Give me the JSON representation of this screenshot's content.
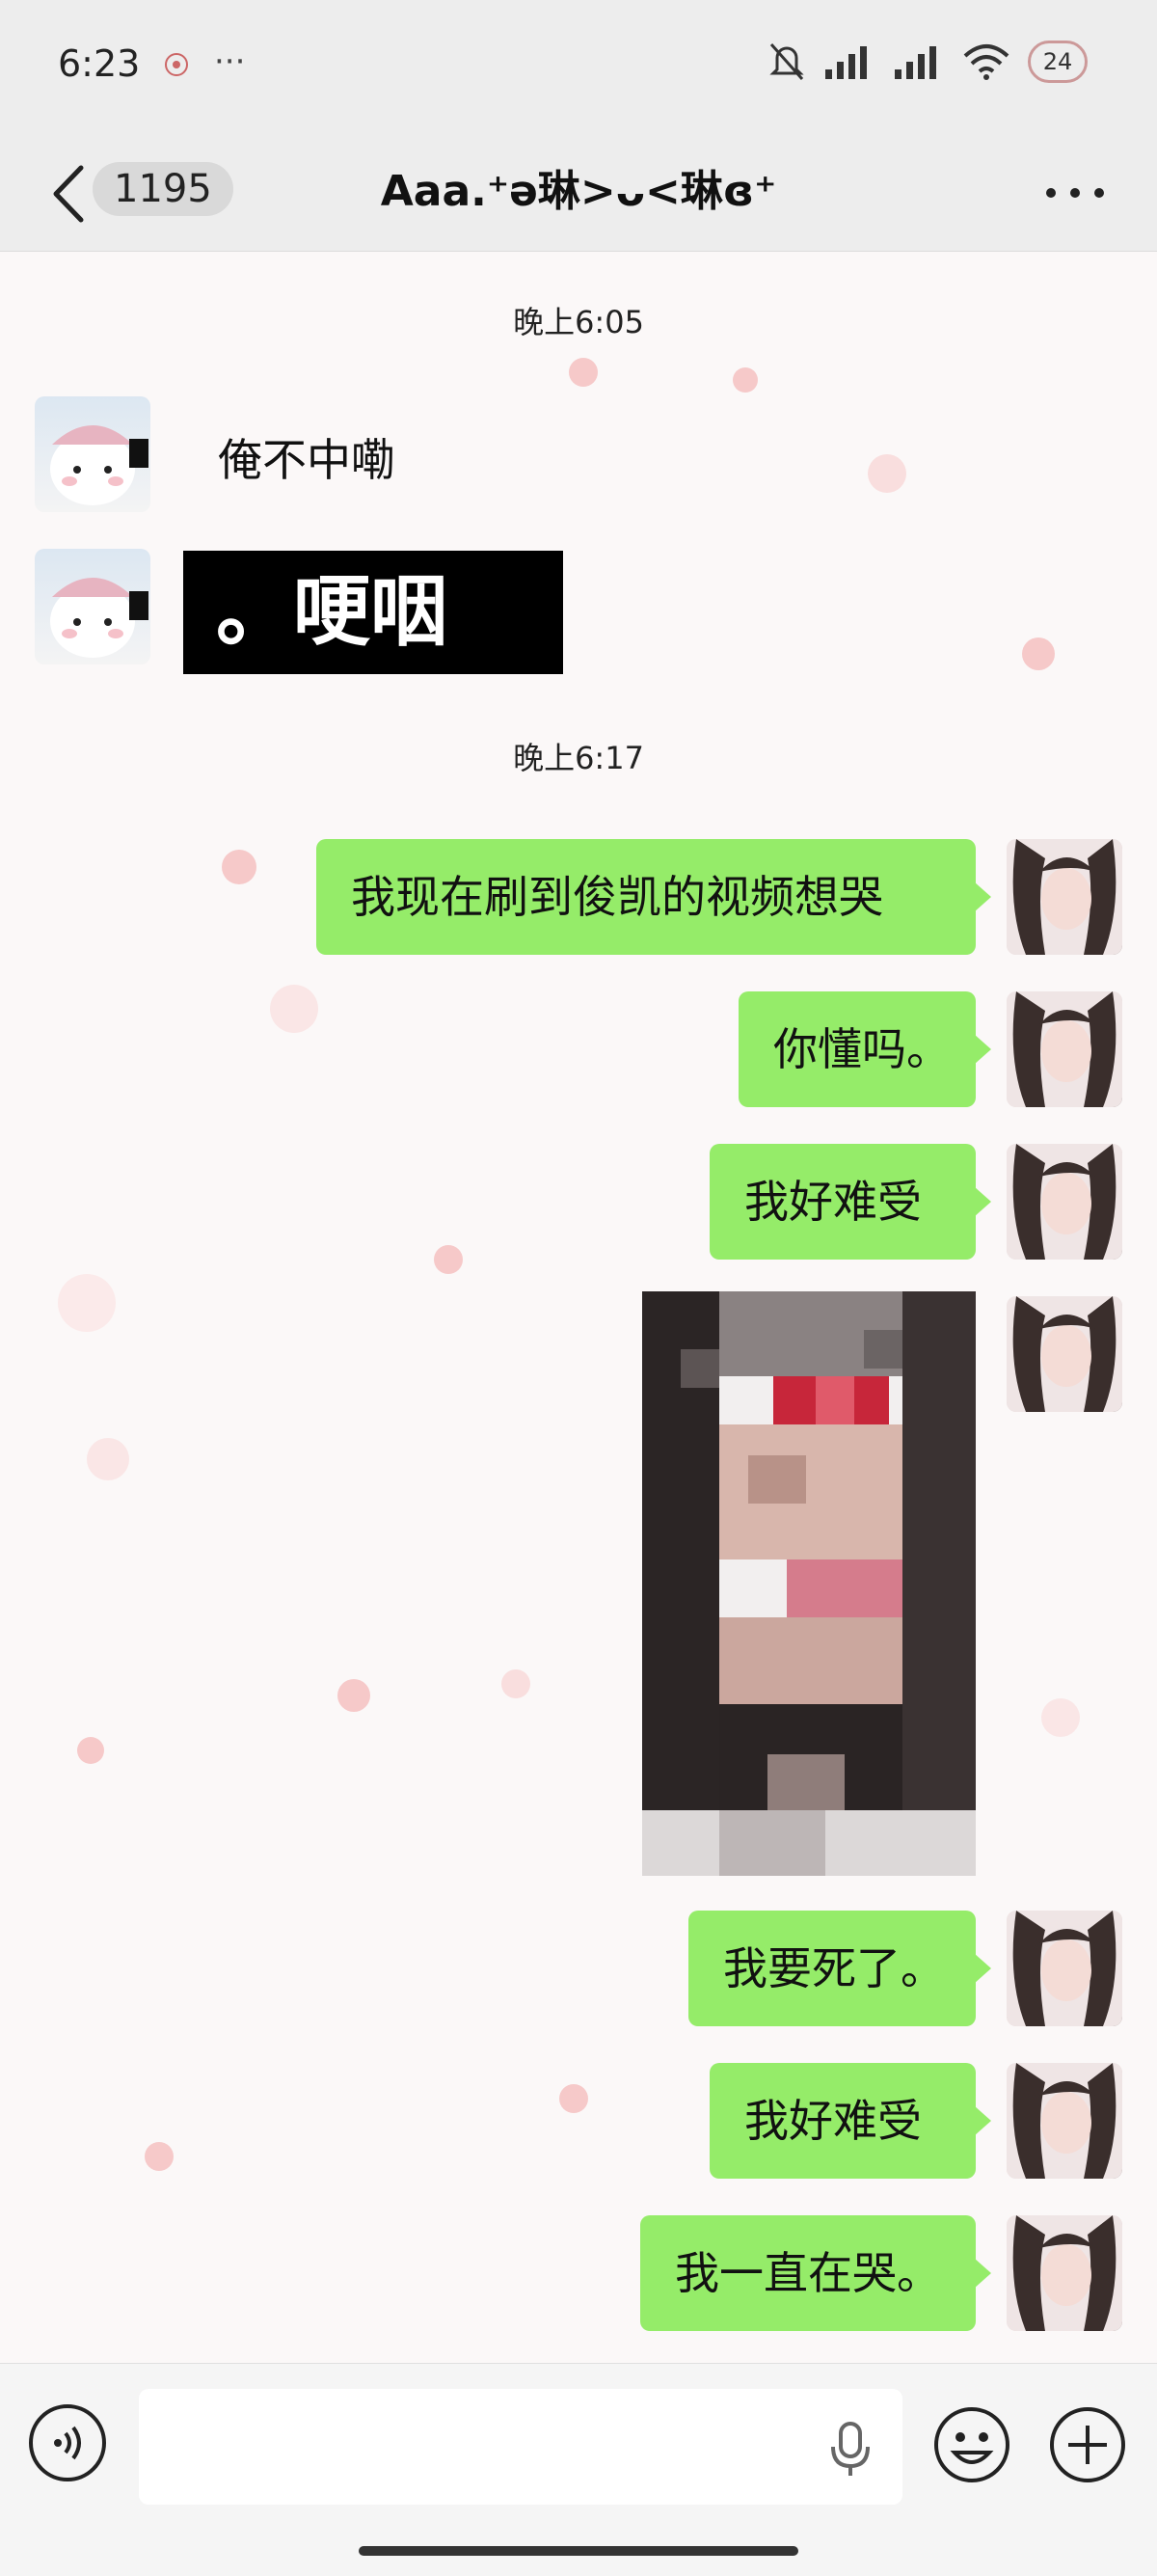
{
  "status_bar": {
    "time": "6:23",
    "notification_icon": "app-notification-icon",
    "more_dots": "···",
    "battery": "24"
  },
  "header": {
    "unread_count": "1195",
    "title": "Aaa.⁺ə琳>ᴗ<琳ɞ⁺"
  },
  "messages": [
    {
      "type": "time",
      "text": "晚上6:05"
    },
    {
      "type": "text",
      "side": "left",
      "text": "俺不中嘞"
    },
    {
      "type": "sticker",
      "side": "left",
      "text": "。哽咽"
    },
    {
      "type": "time",
      "text": "晚上6:17"
    },
    {
      "type": "text",
      "side": "right",
      "text": "我现在刷到俊凯的视频想哭"
    },
    {
      "type": "text",
      "side": "right",
      "text": "你懂吗。"
    },
    {
      "type": "text",
      "side": "right",
      "text": "我好难受"
    },
    {
      "type": "image",
      "side": "right",
      "description": "pixelated-photo"
    },
    {
      "type": "text",
      "side": "right",
      "text": "我要死了。"
    },
    {
      "type": "text",
      "side": "right",
      "text": "我好难受"
    },
    {
      "type": "text",
      "side": "right",
      "text": "我一直在哭。"
    }
  ],
  "input_bar": {
    "voice_icon": "voice-icon",
    "mic_icon": "mic-icon",
    "emoji_icon": "emoji-icon",
    "plus_icon": "plus-icon"
  },
  "colors": {
    "bubble_right": "#95ec69",
    "header_bg": "#ededed",
    "chat_bg": "#fbf8f8"
  }
}
